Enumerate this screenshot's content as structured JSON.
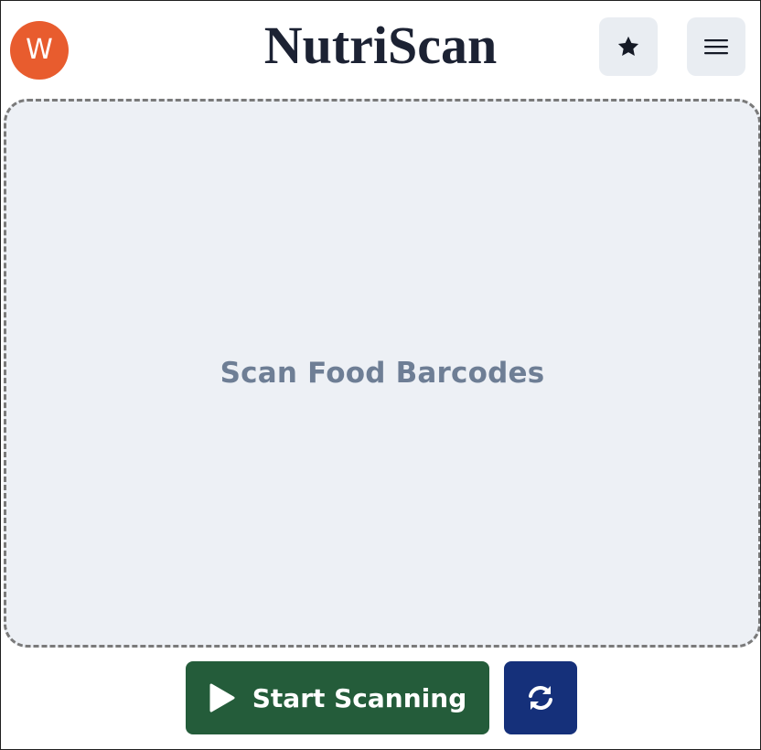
{
  "header": {
    "avatar_initial": "W",
    "title": "NutriScan",
    "favorites_icon": "star-icon",
    "menu_icon": "hamburger-menu-icon"
  },
  "scanner": {
    "prompt": "Scan Food Barcodes"
  },
  "controls": {
    "start_label": "Start Scanning",
    "start_icon": "play-icon",
    "refresh_icon": "refresh-icon"
  },
  "colors": {
    "avatar": "#e85c2e",
    "start_button": "#245c3a",
    "refresh_button": "#15307a",
    "scan_area": "#edf0f5"
  }
}
